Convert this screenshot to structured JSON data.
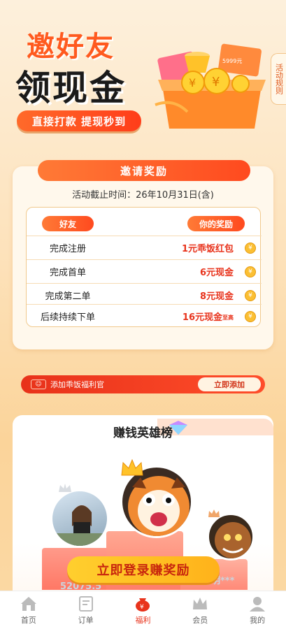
{
  "hero": {
    "title_line1": "邀好友",
    "title_line2": "领现金",
    "subtitle": "直接打款 提现秒到",
    "rules_label": "活动规则",
    "ticket_amount": "5999元"
  },
  "invite": {
    "title": "邀请奖励",
    "deadline": "活动截止时间：26年10月31日(含)",
    "col_friend": "好友",
    "col_reward": "你的奖励",
    "rows": [
      {
        "task": "完成注册",
        "reward": "1元乖饭红包",
        "note": ""
      },
      {
        "task": "完成首单",
        "reward": "6元现金",
        "note": ""
      },
      {
        "task": "完成第二单",
        "reward": "8元现金",
        "note": ""
      },
      {
        "task": "后续持续下单",
        "reward": "16元现金",
        "note": "至高"
      }
    ],
    "coin_glyph": "¥"
  },
  "banner": {
    "text": "添加乖饭福利官",
    "button": "立即添加"
  },
  "leaderboard": {
    "title": "赚钱英雄榜",
    "score_left": "52075.5",
    "score_right": "明***",
    "cta": "立即登录赚奖励"
  },
  "tabs": [
    {
      "label": "首页",
      "icon": "home-icon"
    },
    {
      "label": "订单",
      "icon": "order-icon"
    },
    {
      "label": "福利",
      "icon": "welfare-icon"
    },
    {
      "label": "会员",
      "icon": "crown-icon"
    },
    {
      "label": "我的",
      "icon": "user-icon"
    }
  ],
  "active_tab": "福利",
  "colors": {
    "accent": "#ff4a1f",
    "price": "#e8331c",
    "gold": "#ffc229"
  }
}
